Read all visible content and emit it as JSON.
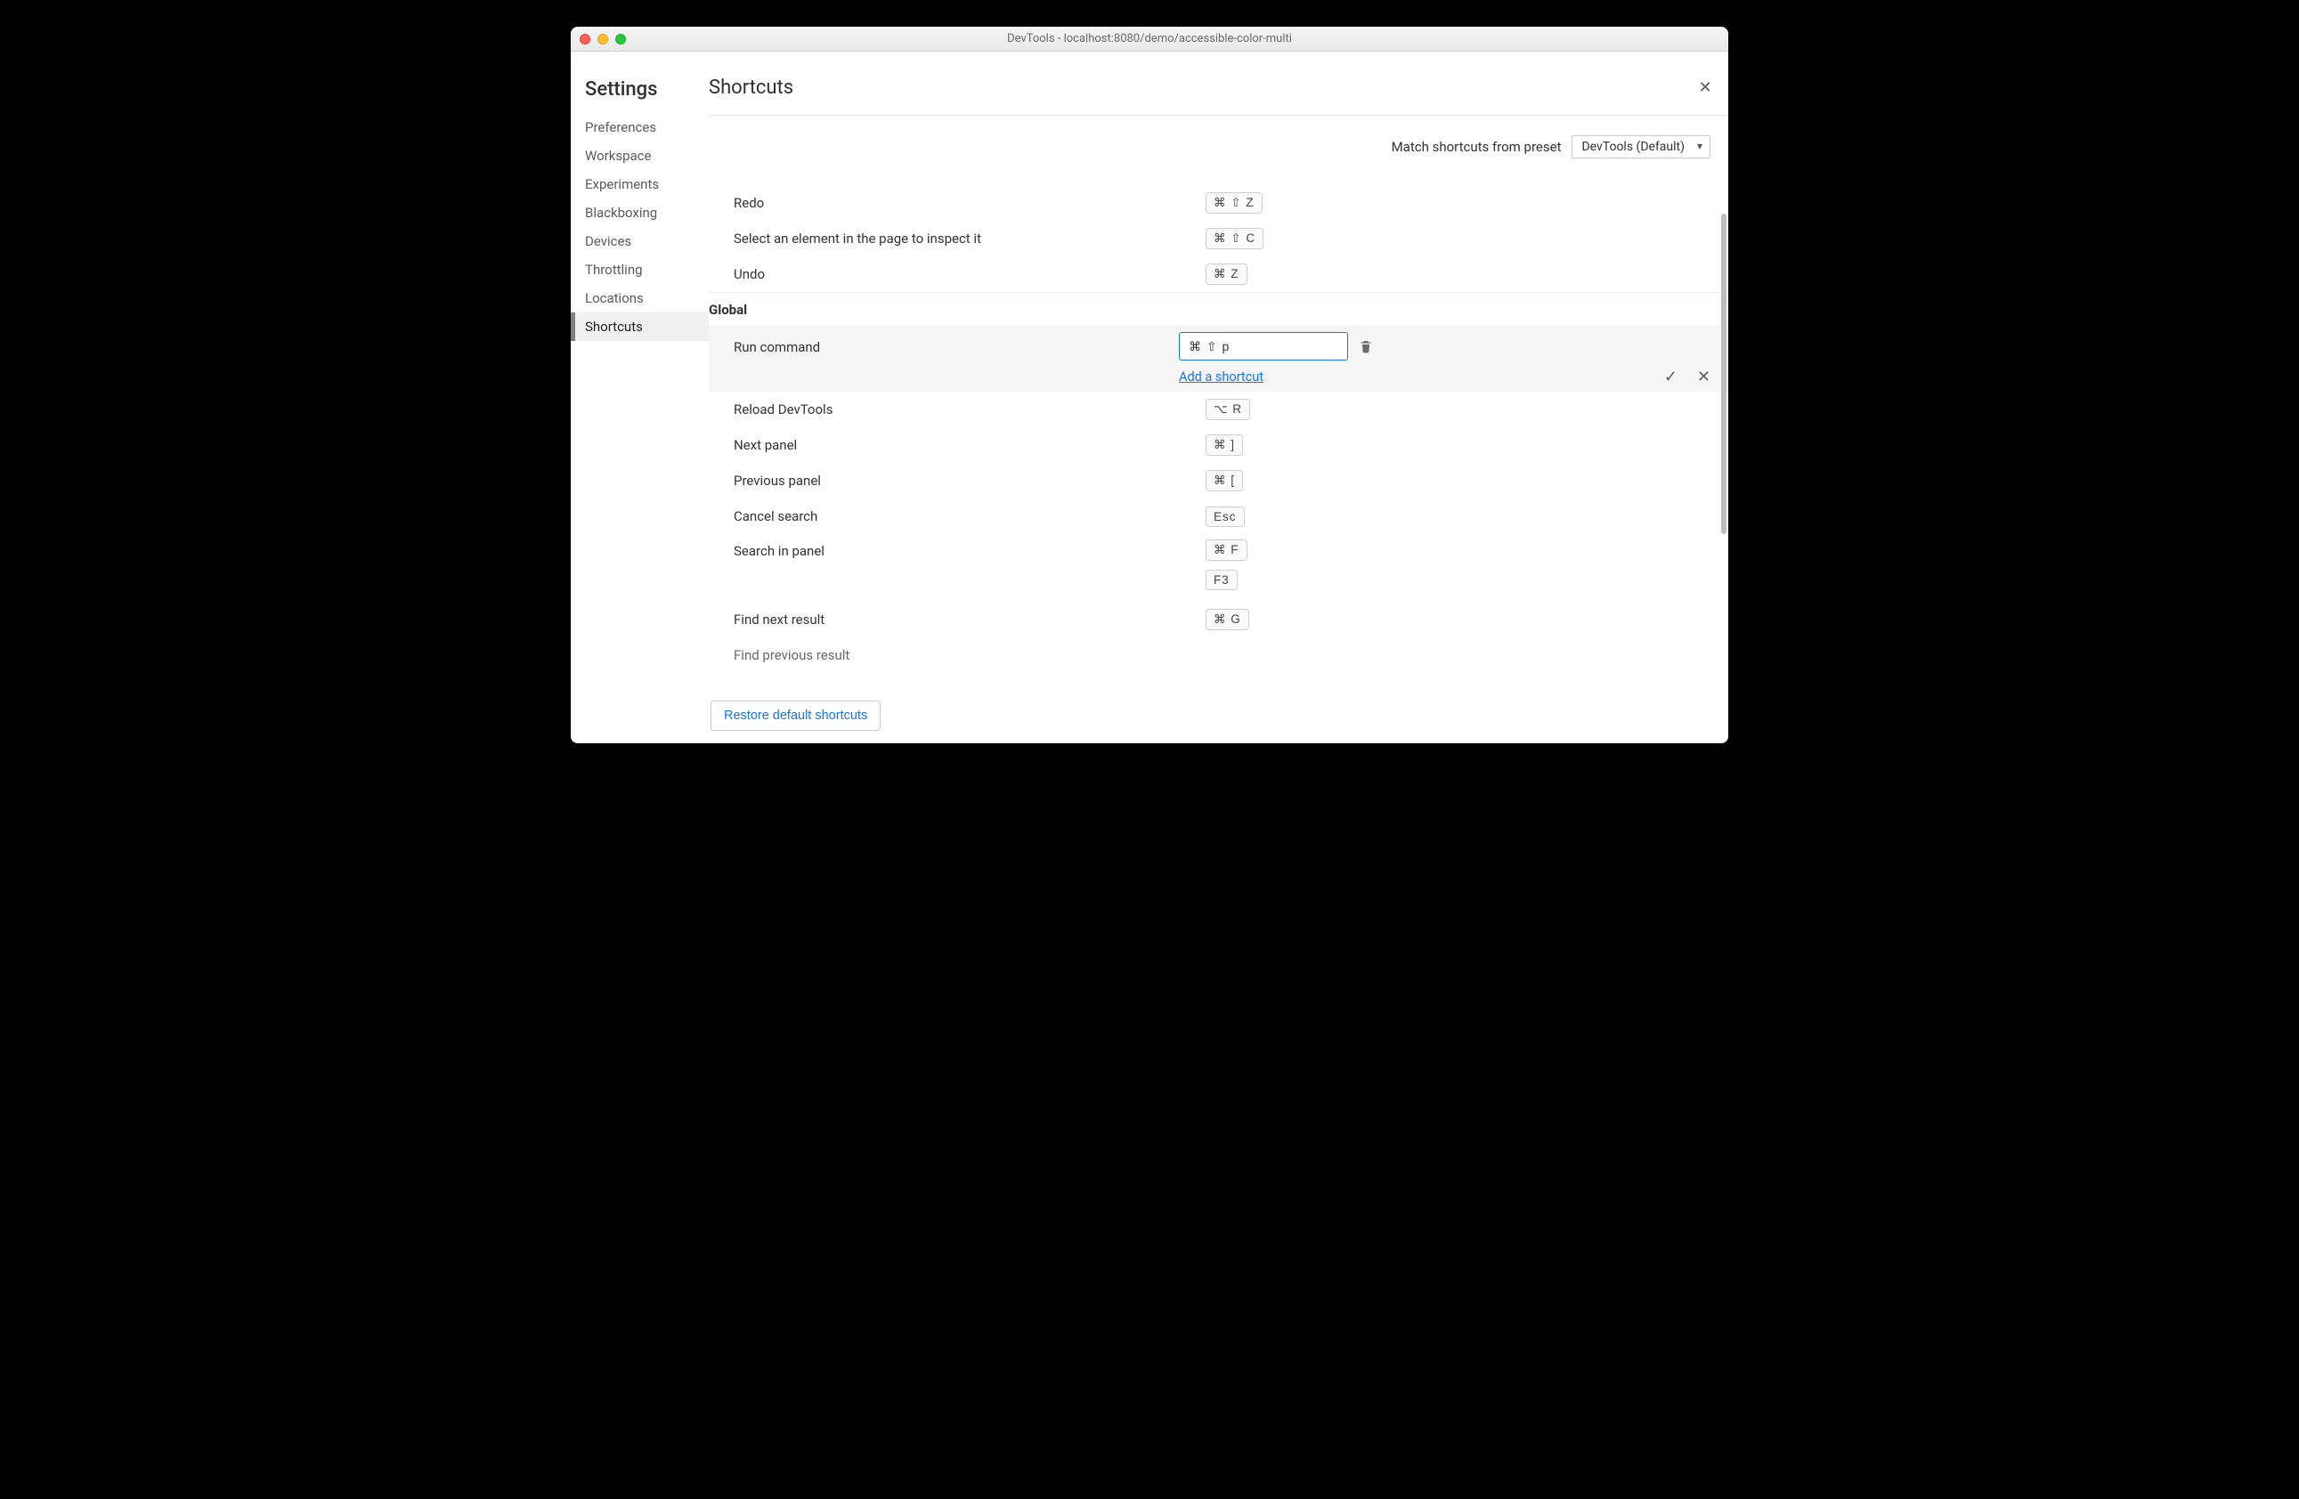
{
  "window": {
    "title": "DevTools - localhost:8080/demo/accessible-color-multi"
  },
  "sidebar": {
    "title": "Settings",
    "items": [
      {
        "label": "Preferences"
      },
      {
        "label": "Workspace"
      },
      {
        "label": "Experiments"
      },
      {
        "label": "Blackboxing"
      },
      {
        "label": "Devices"
      },
      {
        "label": "Throttling"
      },
      {
        "label": "Locations"
      },
      {
        "label": "Shortcuts"
      }
    ],
    "selected_index": 7
  },
  "main": {
    "title": "Shortcuts",
    "preset_label": "Match shortcuts from preset",
    "preset_value": "DevTools (Default)",
    "restore_label": "Restore default shortcuts",
    "add_shortcut_label": "Add a shortcut",
    "topRows": [
      {
        "label": "Redo",
        "key": "⌘ ⇧ Z"
      },
      {
        "label": "Select an element in the page to inspect it",
        "key": "⌘ ⇧ C"
      },
      {
        "label": "Undo",
        "key": "⌘ Z"
      }
    ],
    "global_heading": "Global",
    "edit": {
      "label": "Run command",
      "input_value": "⌘ ⇧ p"
    },
    "globalRows": [
      {
        "label": "Reload DevTools",
        "keys": [
          "⌥ R"
        ]
      },
      {
        "label": "Next panel",
        "keys": [
          "⌘ ]"
        ]
      },
      {
        "label": "Previous panel",
        "keys": [
          "⌘ ["
        ]
      },
      {
        "label": "Cancel search",
        "keys": [
          "Esc"
        ]
      },
      {
        "label": "Search in panel",
        "keys": [
          "⌘ F",
          "F3"
        ]
      },
      {
        "label": "Find next result",
        "keys": [
          "⌘ G"
        ]
      },
      {
        "label": "Find previous result",
        "keys": []
      }
    ]
  }
}
